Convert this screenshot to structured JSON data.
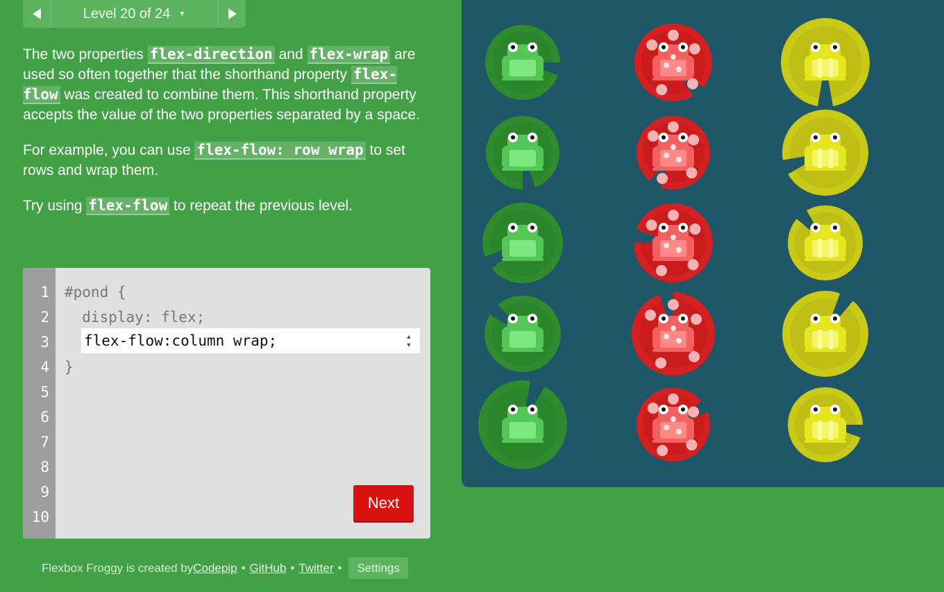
{
  "header": {
    "level_text": "Level 20 of 24",
    "caret": "▼"
  },
  "instructions": {
    "p1_a": "The two properties ",
    "p1_code1": "flex-direction",
    "p1_b": " and ",
    "p1_code2": "flex-wrap",
    "p1_c": " are used so often together that the shorthand property ",
    "p1_code3": "flex-flow",
    "p1_d": " was created to combine them. This shorthand property accepts the value of the two properties separated by a space.",
    "p2_a": "For example, you can use ",
    "p2_code": "flex-flow: row wrap",
    "p2_b": " to set rows and wrap them.",
    "p3_a": "Try using ",
    "p3_code": "flex-flow",
    "p3_b": " to repeat the previous level."
  },
  "editor": {
    "line_numbers": [
      "1",
      "2",
      "3",
      "4",
      "5",
      "6",
      "7",
      "8",
      "9",
      "10"
    ],
    "line1": "#pond {",
    "line2": "  display: flex;",
    "line4": "}",
    "input_value": "flex-flow:column wrap;",
    "next_label": "Next"
  },
  "footer": {
    "credit_text": "Flexbox Froggy is created by ",
    "codepip": "Codepip",
    "github": "GitHub",
    "twitter": "Twitter",
    "bullet": "•",
    "settings": "Settings"
  },
  "colors": {
    "background": "#42a046",
    "pond": "#1f5768",
    "green_pad": "#2e8b2e",
    "red_pad": "#d42020",
    "yellow_pad": "#c9c918",
    "next_button": "#d8120e"
  },
  "pond": {
    "frog_colors": [
      "green",
      "red",
      "yellow"
    ],
    "frogs_per_column": 5
  }
}
